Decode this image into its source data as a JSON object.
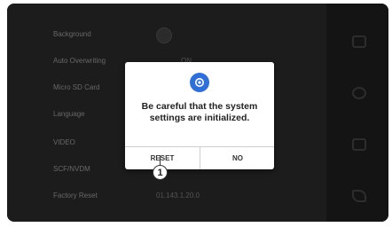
{
  "settings": {
    "rows": [
      {
        "label": "Background",
        "value": ""
      },
      {
        "label": "Auto Overwriting",
        "value": "ON"
      },
      {
        "label": "Micro SD Card",
        "value": ""
      },
      {
        "label": "Language",
        "value": ""
      },
      {
        "label": "VIDEO",
        "value": ""
      },
      {
        "label": "SCF/NVDM",
        "value": ""
      },
      {
        "label": "Factory Reset",
        "value": "01.143.1.20.0"
      }
    ]
  },
  "sidebar": {
    "icons": [
      "home-icon",
      "settings-icon",
      "display-icon",
      "call-icon"
    ]
  },
  "dialog": {
    "icon": "gear-icon",
    "message": "Be careful that the system settings are initialized.",
    "reset_label": "RESET",
    "no_label": "NO",
    "accent_color": "#2f6fd6"
  },
  "callout": {
    "label": "1"
  }
}
